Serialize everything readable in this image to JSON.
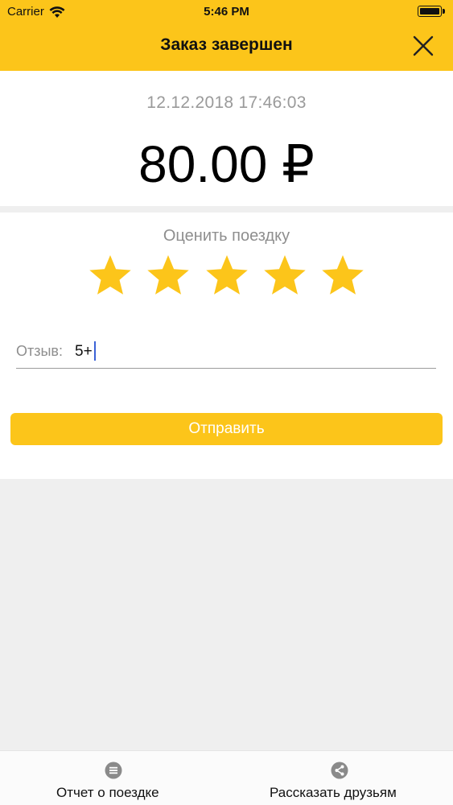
{
  "status_bar": {
    "carrier": "Carrier",
    "time": "5:46 PM",
    "wifi_icon": "wifi-icon",
    "battery_icon": "battery-icon"
  },
  "header": {
    "title": "Заказ завершен",
    "close_icon": "close-icon",
    "background": "#fcc51a"
  },
  "order": {
    "datetime": "12.12.2018 17:46:03",
    "amount": "80.00 ₽"
  },
  "rating": {
    "label": "Оценить поездку",
    "stars_total": 5,
    "stars_selected": 5,
    "star_color": "#fcc51a"
  },
  "review": {
    "label": "Отзыв:",
    "value": "5+"
  },
  "send_button": {
    "label": "Отправить"
  },
  "tabbar": {
    "items": [
      {
        "label": "Отчет о поездке",
        "icon": "list-icon"
      },
      {
        "label": "Рассказать друзьям",
        "icon": "share-icon"
      }
    ]
  }
}
